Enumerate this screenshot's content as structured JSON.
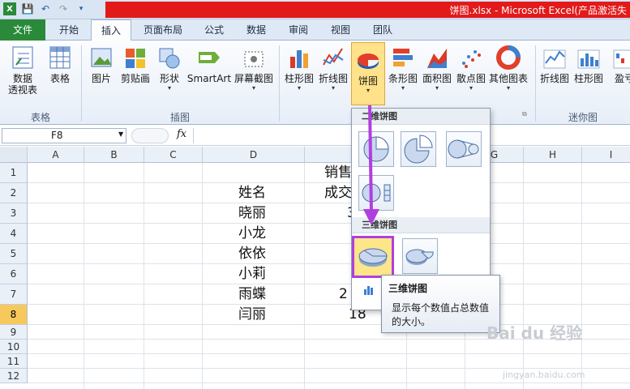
{
  "window": {
    "title": "饼图.xlsx  -  Microsoft Excel(产品激活失"
  },
  "tabs": [
    "文件",
    "开始",
    "插入",
    "页面布局",
    "公式",
    "数据",
    "审阅",
    "视图",
    "团队"
  ],
  "ribbon": {
    "pivot": "数据",
    "pivot2": "透视表",
    "table": "表格",
    "picture": "图片",
    "clipart": "剪贴画",
    "shapes": "形状",
    "smartart": "SmartArt",
    "screenshot": "屏幕截图",
    "column": "柱形图",
    "line": "折线图",
    "pie": "饼图",
    "bar": "条形图",
    "area": "面积图",
    "scatter": "散点图",
    "other": "其他图表",
    "sp_line": "折线图",
    "sp_col": "柱形图",
    "sp_wl": "盈亏",
    "g_tables": "表格",
    "g_illus": "插图",
    "g_spark": "迷你图"
  },
  "formula": {
    "name_box": "F8",
    "fx": "fx"
  },
  "columns": [
    "A",
    "B",
    "C",
    "D",
    "E",
    "F",
    "G",
    "H",
    "I"
  ],
  "rows": [
    "1",
    "2",
    "3",
    "4",
    "5",
    "6",
    "7",
    "8",
    "9",
    "10",
    "11",
    "12"
  ],
  "cells": {
    "e1": "销售",
    "d2": "姓名",
    "e2": "成交",
    "d3": "晓丽",
    "d4": "小龙",
    "d5": "依依",
    "d6": "小莉",
    "d7": "雨蝶",
    "d8": "闫丽",
    "e3": "3",
    "e7": "2",
    "e8": "18"
  },
  "gallery": {
    "h2d": "二维饼图",
    "h3d": "三维饼图"
  },
  "tooltip": {
    "title": "三维饼图",
    "desc": "显示每个数值占总数值的大小。"
  },
  "watermark": {
    "main": "Bai du 经验",
    "sub": "jingyan.baidu.com"
  }
}
